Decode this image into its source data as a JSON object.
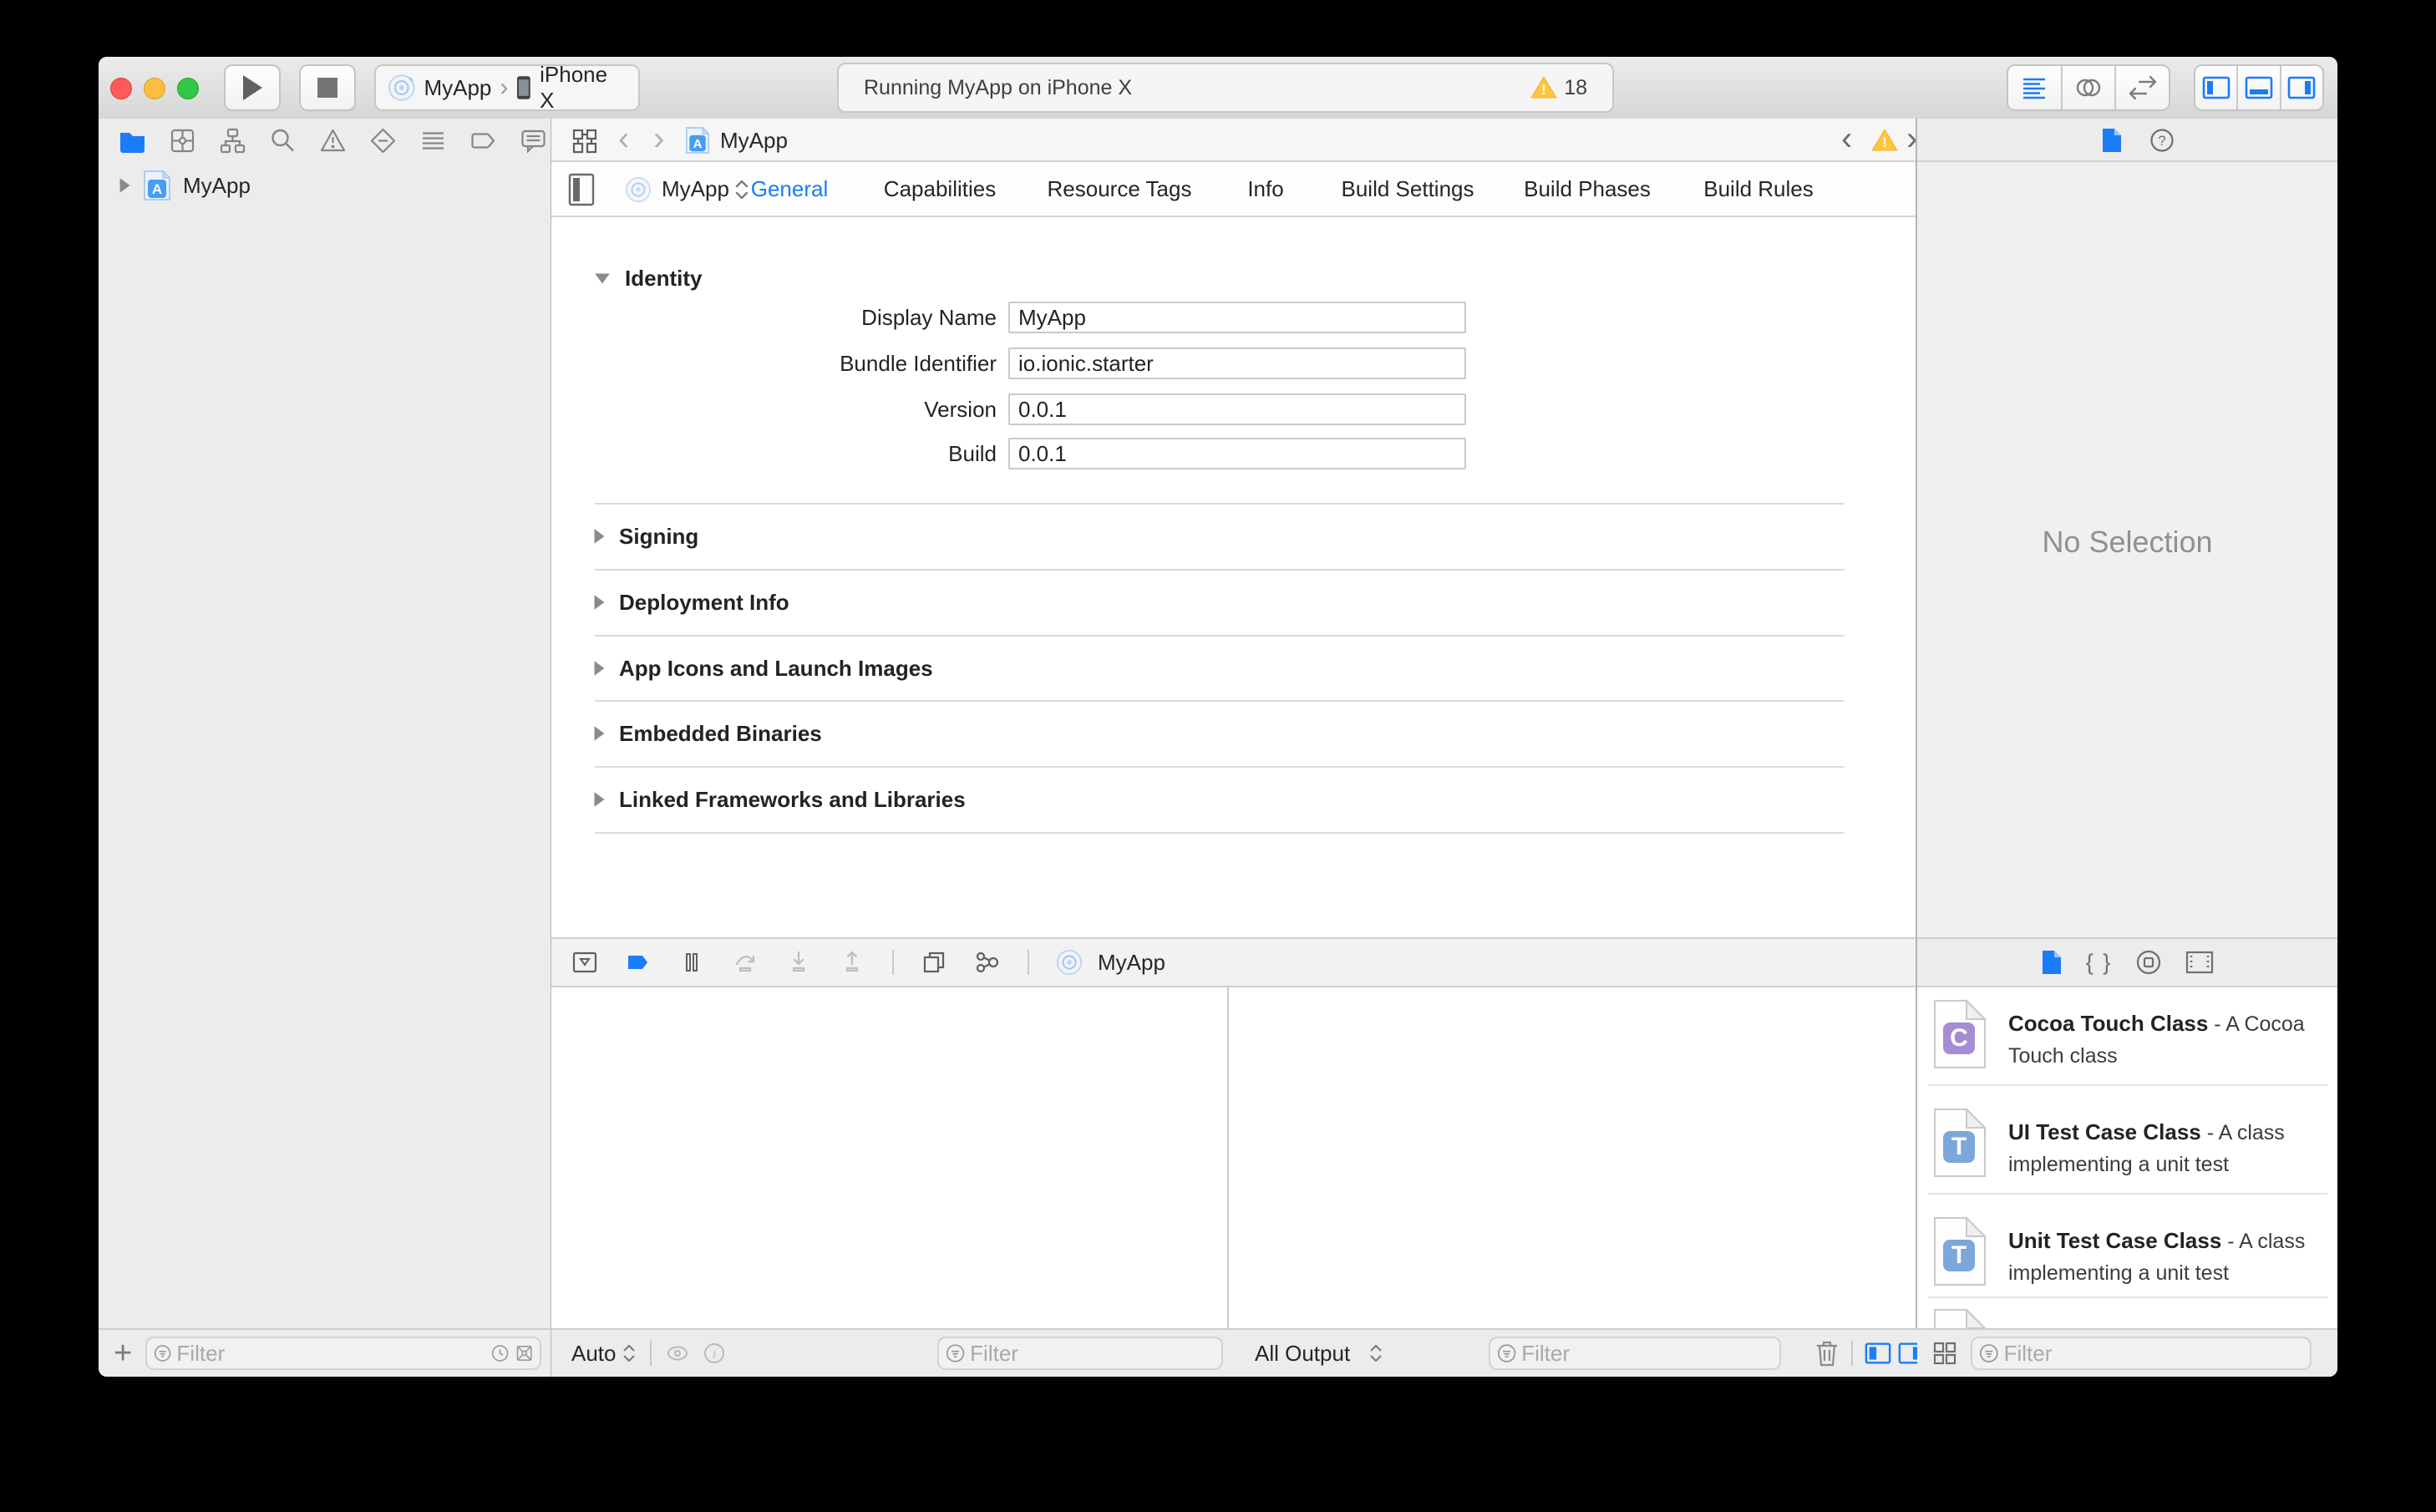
{
  "colors": {
    "accent": "#1b7cf8",
    "warning": "#fec53d",
    "traffic_red": "#fc5b57",
    "traffic_yellow": "#fdbe3f",
    "traffic_green": "#33c648",
    "cocoa_class_icon": "#a78cd3",
    "test_class_icon": "#7ba7db"
  },
  "toolbar": {
    "scheme_app": "MyApp",
    "scheme_separator": "›",
    "scheme_device": "iPhone X",
    "status_text": "Running MyApp on iPhone X",
    "warning_count": "18"
  },
  "navigator": {
    "project_name": "MyApp",
    "add_label": "+",
    "filter_placeholder": "Filter"
  },
  "jumpbar": {
    "back": "‹",
    "forward": "›",
    "current_file": "MyApp"
  },
  "editor": {
    "target_name": "MyApp",
    "tabs": [
      "General",
      "Capabilities",
      "Resource Tags",
      "Info",
      "Build Settings",
      "Build Phases",
      "Build Rules"
    ],
    "identity_title": "Identity",
    "fields": [
      {
        "label": "Display Name",
        "value": "MyApp"
      },
      {
        "label": "Bundle Identifier",
        "value": "io.ionic.starter"
      },
      {
        "label": "Version",
        "value": "0.0.1"
      },
      {
        "label": "Build",
        "value": "0.0.1"
      }
    ],
    "sections": [
      "Signing",
      "Deployment Info",
      "App Icons and Launch Images",
      "Embedded Binaries",
      "Linked Frameworks and Libraries"
    ]
  },
  "debug": {
    "breadcrumb": "MyApp",
    "variables_scope": "Auto",
    "console_scope": "All Output",
    "variables_filter_placeholder": "Filter",
    "console_filter_placeholder": "Filter"
  },
  "inspector": {
    "empty_message": "No Selection",
    "help_glyph": "?",
    "snippet_glyph": "{ }",
    "filter_placeholder": "Filter",
    "library_items": [
      {
        "letter": "C",
        "name": "Cocoa Touch Class",
        "desc": " - A Cocoa Touch class"
      },
      {
        "letter": "T",
        "name": "UI Test Case Class",
        "desc": " - A class implementing a unit test"
      },
      {
        "letter": "T",
        "name": "Unit Test Case Class",
        "desc": " - A class implementing a unit test"
      }
    ]
  }
}
